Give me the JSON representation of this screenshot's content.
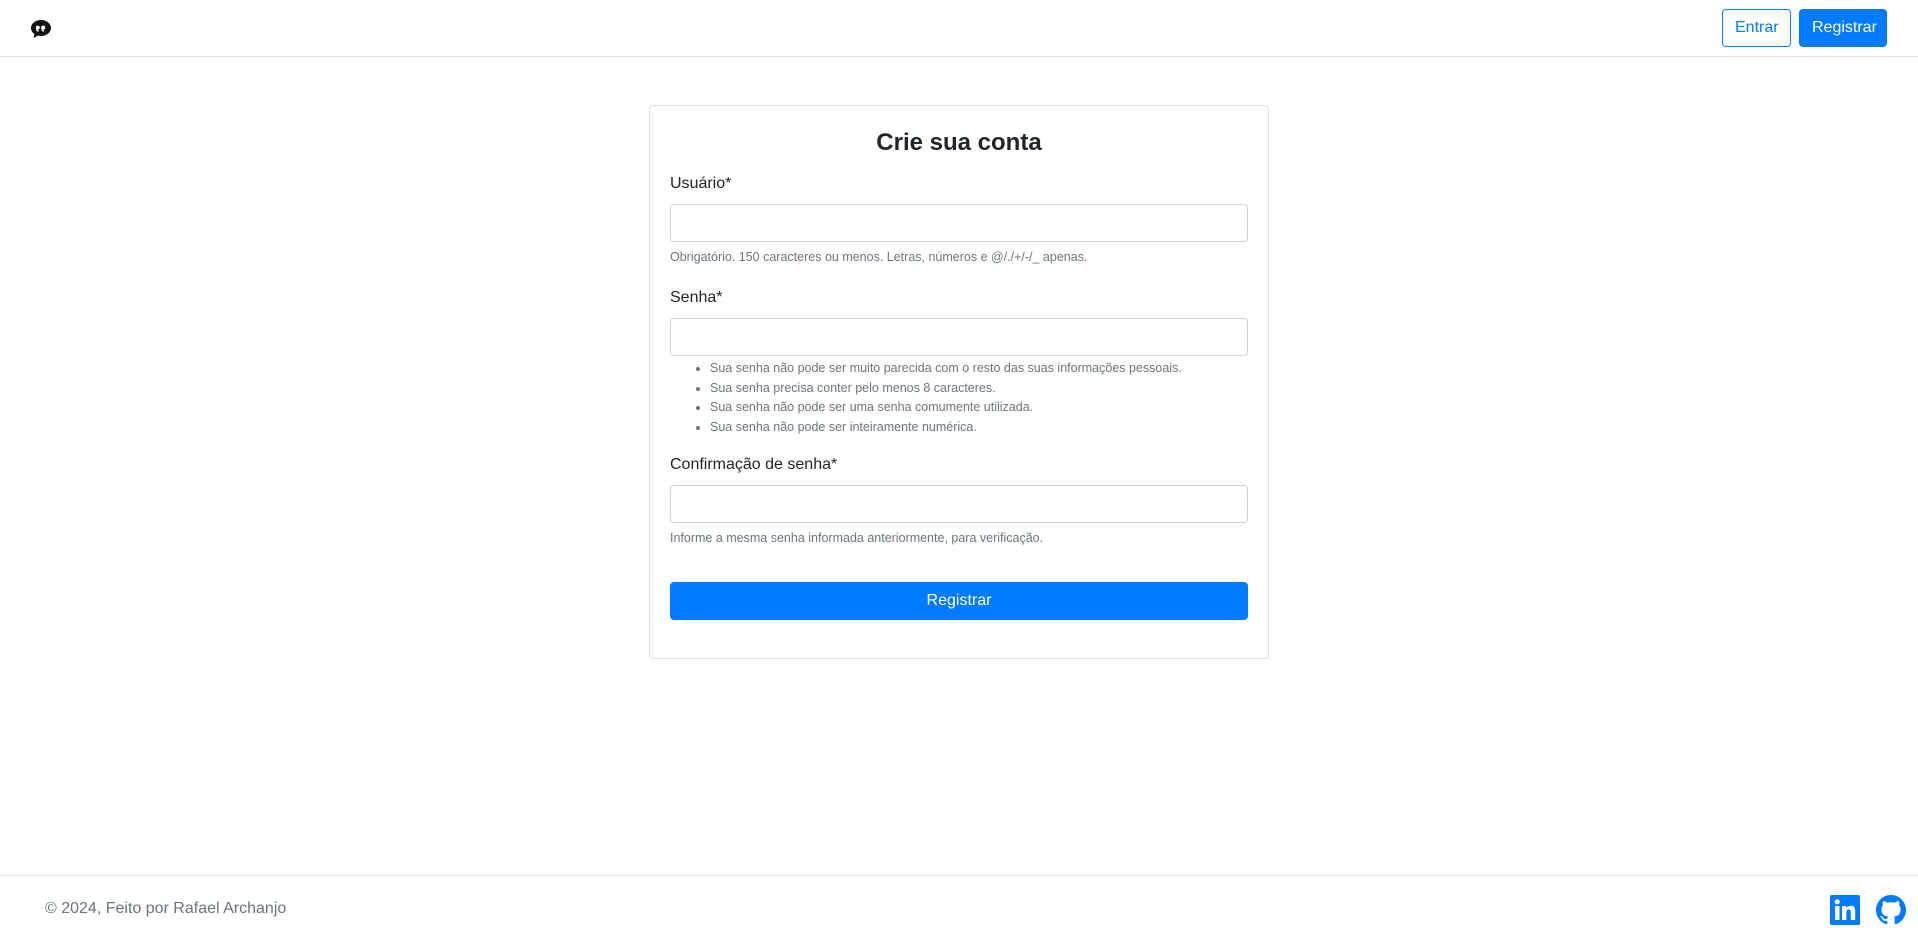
{
  "header": {
    "brand_icon": "chat-quote-icon",
    "login_label": "Entrar",
    "register_label": "Registrar"
  },
  "form": {
    "title": "Crie sua conta",
    "username": {
      "label": "Usuário*",
      "value": "",
      "help": "Obrigatório. 150 caracteres ou menos. Letras, números e @/./+/-/_ apenas."
    },
    "password": {
      "label": "Senha*",
      "value": "",
      "rules": [
        "Sua senha não pode ser muito parecida com o resto das suas informações pessoais.",
        "Sua senha precisa conter pelo menos 8 caracteres.",
        "Sua senha não pode ser uma senha comumente utilizada.",
        "Sua senha não pode ser inteiramente numérica."
      ]
    },
    "password_confirm": {
      "label": "Confirmação de senha*",
      "value": "",
      "help": "Informe a mesma senha informada anteriormente, para verificação."
    },
    "submit_label": "Registrar"
  },
  "footer": {
    "copyright": "© 2024, Feito por Rafael Archanjo",
    "social_icons": [
      "linkedin-icon",
      "github-icon"
    ]
  },
  "colors": {
    "primary": "#007bff",
    "muted": "#6c757d",
    "border": "#dee2e6",
    "text": "#212529"
  }
}
